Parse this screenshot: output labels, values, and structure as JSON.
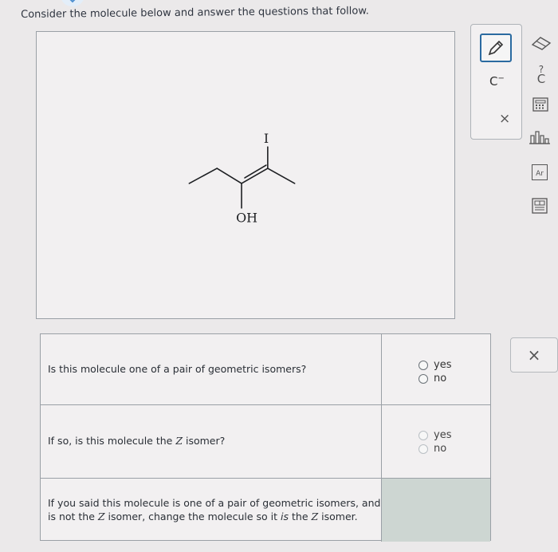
{
  "prompt": "Consider the molecule below and answer the questions that follow.",
  "molecule": {
    "atoms": {
      "iodine": "I",
      "hydroxyl": "OH"
    }
  },
  "toolbar": {
    "carbanion_label": "C",
    "carbanion_charge": "−",
    "close_glyph": "×"
  },
  "side_tools": {
    "question_c_label": "C",
    "ar_label": "Ar"
  },
  "questions": [
    {
      "text": "Is this molecule one of a pair of geometric isomers?",
      "options": [
        "yes",
        "no"
      ]
    },
    {
      "text_before": "If so, is this molecule the ",
      "text_z": "Z",
      "text_after": " isomer?",
      "options": [
        "yes",
        "no"
      ]
    },
    {
      "line1_before": "If you said this molecule is one of a pair of geometric isomers, and",
      "line2_before": "is not the ",
      "line2_z": "Z",
      "line2_mid": " isomer, change the molecule so it ",
      "line2_is": "is",
      "line2_mid2": " the ",
      "line2_z2": "Z",
      "line2_after": " isomer."
    }
  ],
  "close_button_glyph": "×"
}
